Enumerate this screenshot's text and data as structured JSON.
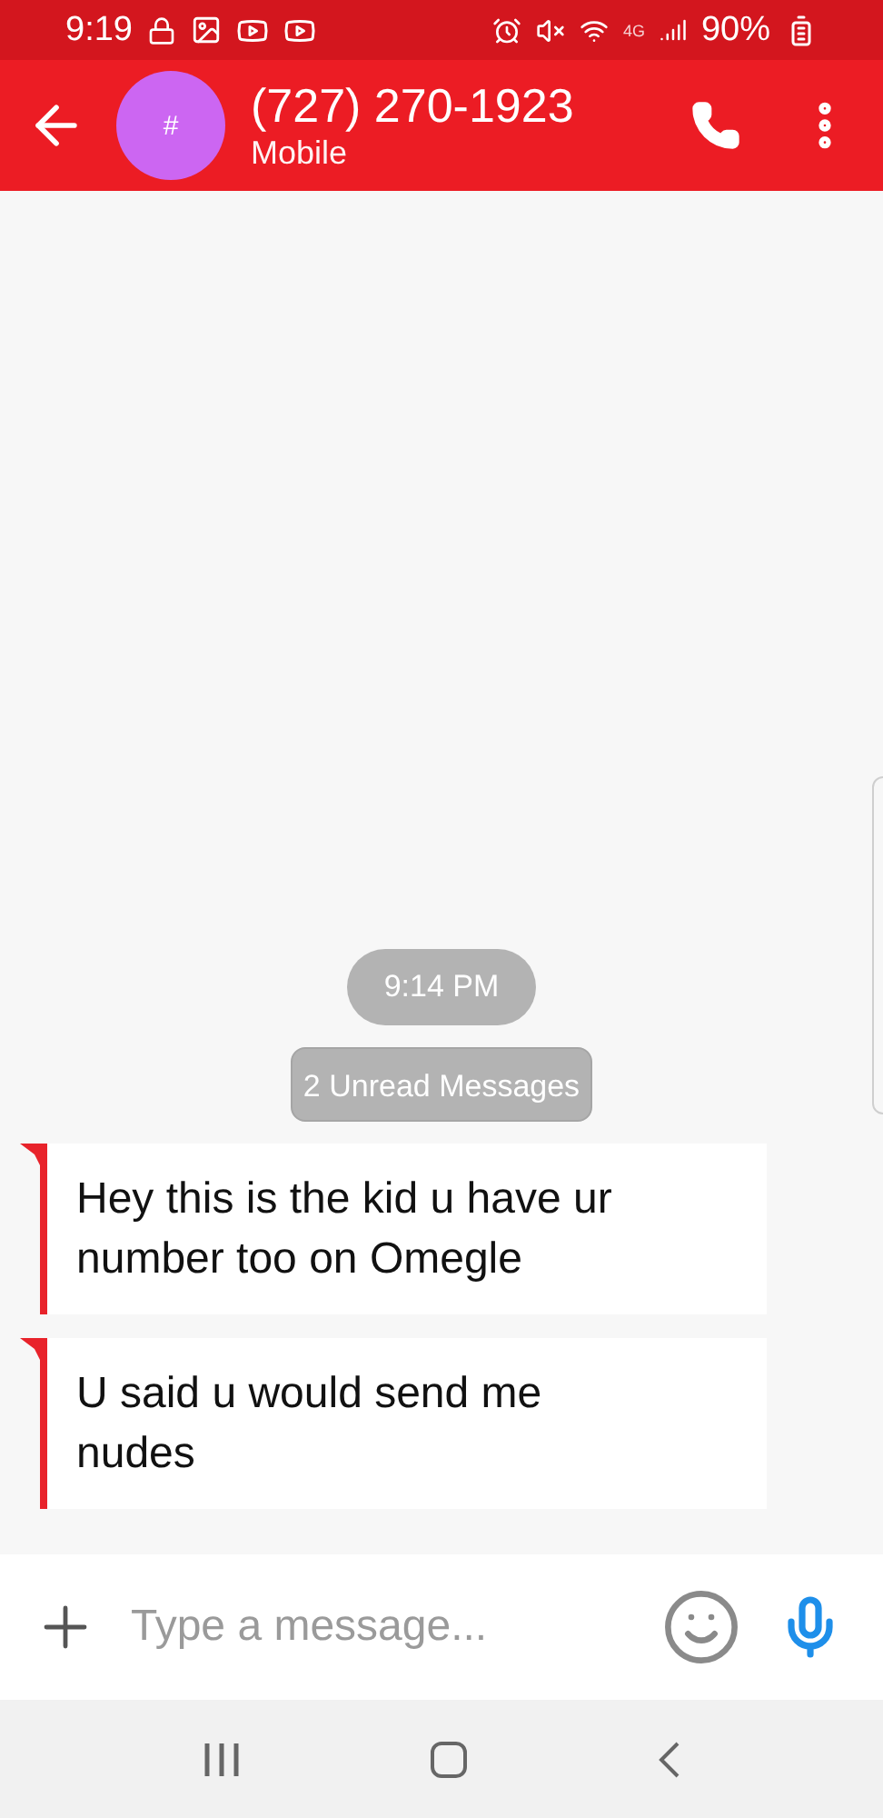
{
  "status_bar": {
    "time": "9:19",
    "network": "4G",
    "battery": "90%"
  },
  "header": {
    "avatar_text": "#",
    "title": "(727) 270-1923",
    "subtitle": "Mobile"
  },
  "conversation": {
    "timestamp": "9:14 PM",
    "unread_label": "2 Unread Messages",
    "messages": [
      {
        "text": "Hey this is the kid u have ur number too on Omegle"
      },
      {
        "text": "U said u would send me nudes"
      }
    ]
  },
  "composer": {
    "placeholder": "Type a message..."
  }
}
